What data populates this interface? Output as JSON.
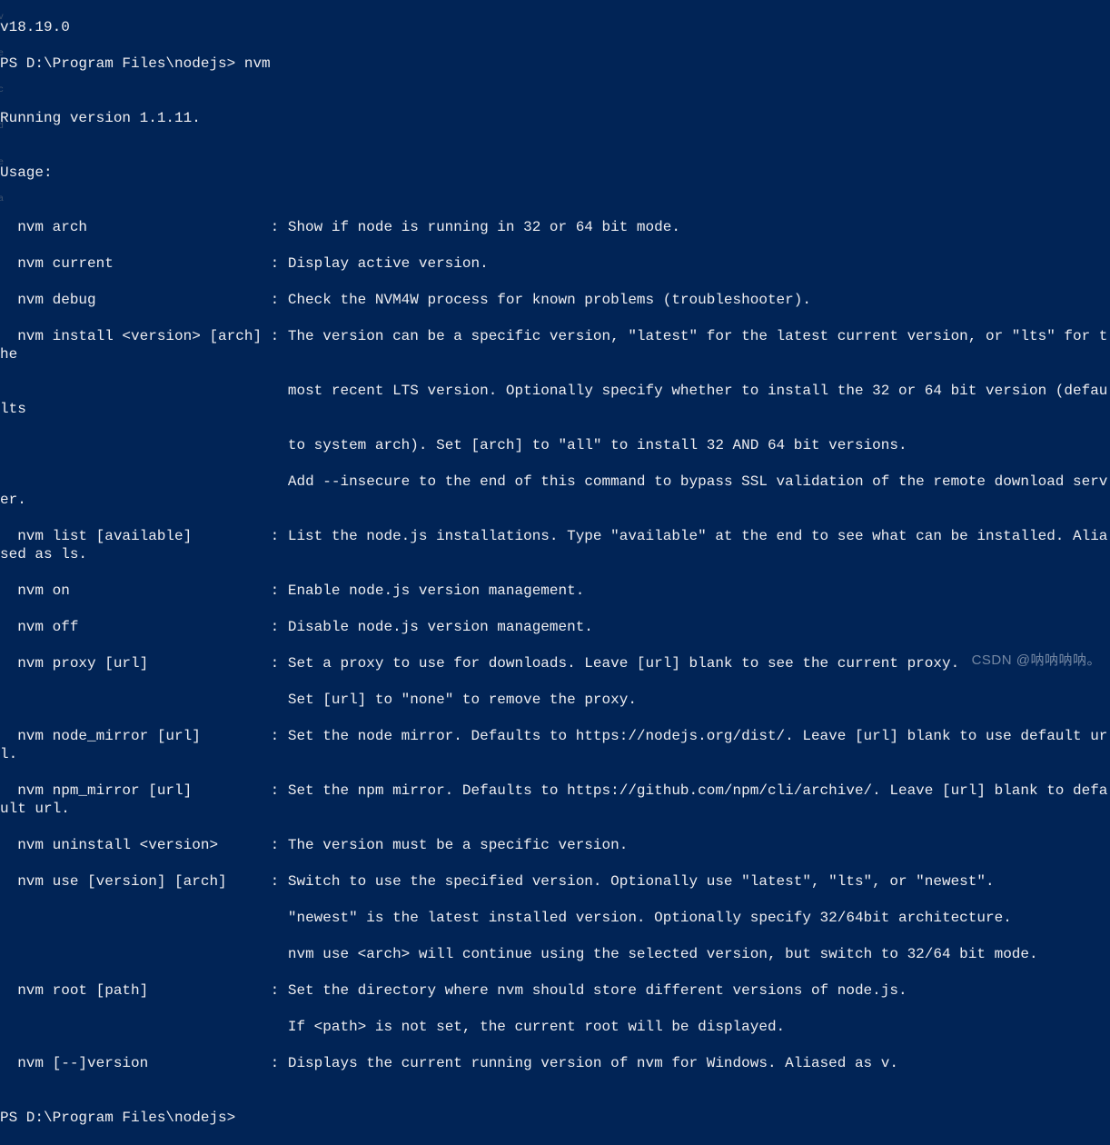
{
  "gutter_chars": "v\ne\nc\nd\ne\n\n\n\n\n\n\n\n\n\na\n\n\n",
  "terminal": {
    "lines": [
      "v18.19.0",
      "PS D:\\Program Files\\nodejs> nvm",
      "",
      "Running version 1.1.11.",
      "",
      "Usage:",
      "",
      "  nvm arch                     : Show if node is running in 32 or 64 bit mode.",
      "  nvm current                  : Display active version.",
      "  nvm debug                    : Check the NVM4W process for known problems (troubleshooter).",
      "  nvm install <version> [arch] : The version can be a specific version, \"latest\" for the latest current version, or \"lts\" for the",
      "                                 most recent LTS version. Optionally specify whether to install the 32 or 64 bit version (defaults",
      "                                 to system arch). Set [arch] to \"all\" to install 32 AND 64 bit versions.",
      "                                 Add --insecure to the end of this command to bypass SSL validation of the remote download server.",
      "  nvm list [available]         : List the node.js installations. Type \"available\" at the end to see what can be installed. Aliased as ls.",
      "  nvm on                       : Enable node.js version management.",
      "  nvm off                      : Disable node.js version management.",
      "  nvm proxy [url]              : Set a proxy to use for downloads. Leave [url] blank to see the current proxy.",
      "                                 Set [url] to \"none\" to remove the proxy.",
      "  nvm node_mirror [url]        : Set the node mirror. Defaults to https://nodejs.org/dist/. Leave [url] blank to use default url.",
      "  nvm npm_mirror [url]         : Set the npm mirror. Defaults to https://github.com/npm/cli/archive/. Leave [url] blank to default url.",
      "  nvm uninstall <version>      : The version must be a specific version.",
      "  nvm use [version] [arch]     : Switch to use the specified version. Optionally use \"latest\", \"lts\", or \"newest\".",
      "                                 \"newest\" is the latest installed version. Optionally specify 32/64bit architecture.",
      "                                 nvm use <arch> will continue using the selected version, but switch to 32/64 bit mode.",
      "  nvm root [path]              : Set the directory where nvm should store different versions of node.js.",
      "                                 If <path> is not set, the current root will be displayed.",
      "  nvm [--]version              : Displays the current running version of nvm for Windows. Aliased as v.",
      "",
      "PS D:\\Program Files\\nodejs>"
    ]
  },
  "watermark": "CSDN @呐呐呐呐。"
}
